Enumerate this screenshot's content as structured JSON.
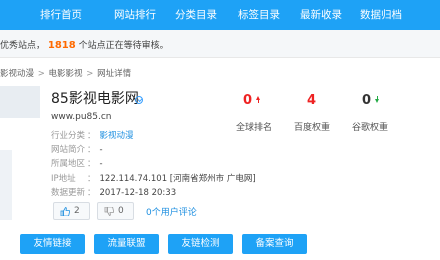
{
  "nav": {
    "items": [
      "排行首页",
      "网站排行",
      "分类目录",
      "标签目录",
      "最新收录",
      "数据归档"
    ]
  },
  "notice": {
    "prefix": "优秀站点，",
    "count": "1818",
    "suffix": "个站点正在等待审核。"
  },
  "breadcrumb": {
    "items": [
      "影视动漫",
      "电影影视",
      "网址详情"
    ],
    "separator": ">"
  },
  "site": {
    "title": "85影视电影网",
    "url": "www.pu85.cn",
    "category_label": "行业分类",
    "category_value": "影视动漫",
    "intro_label": "网站简介",
    "intro_value": "-",
    "region_label": "所属地区",
    "region_value": "-",
    "ip_label": "IP地址",
    "ip_value": "122.114.74.101 [河南省郑州市 广电网]",
    "updated_label": "数据更新",
    "updated_value": "2017-12-18 20:33"
  },
  "stats": {
    "global_rank": "0",
    "global_rank_label": "全球排名",
    "baidu_weight": "4",
    "baidu_weight_label": "百度权重",
    "google_weight": "0",
    "google_weight_label": "谷歌权重"
  },
  "votes": {
    "up": "2",
    "down": "0",
    "comments": "0个用户评论"
  },
  "buttons": {
    "friend_links": "友情链接",
    "traffic_alliance": "流量联盟",
    "link_check": "友链检测",
    "icp_lookup": "备案查询"
  },
  "colors": {
    "primary": "#1ea2f6",
    "count_orange": "#ff6a00",
    "rank_red": "#ee2222",
    "google_green": "#22aa44",
    "link_blue": "#1e8fe0"
  }
}
